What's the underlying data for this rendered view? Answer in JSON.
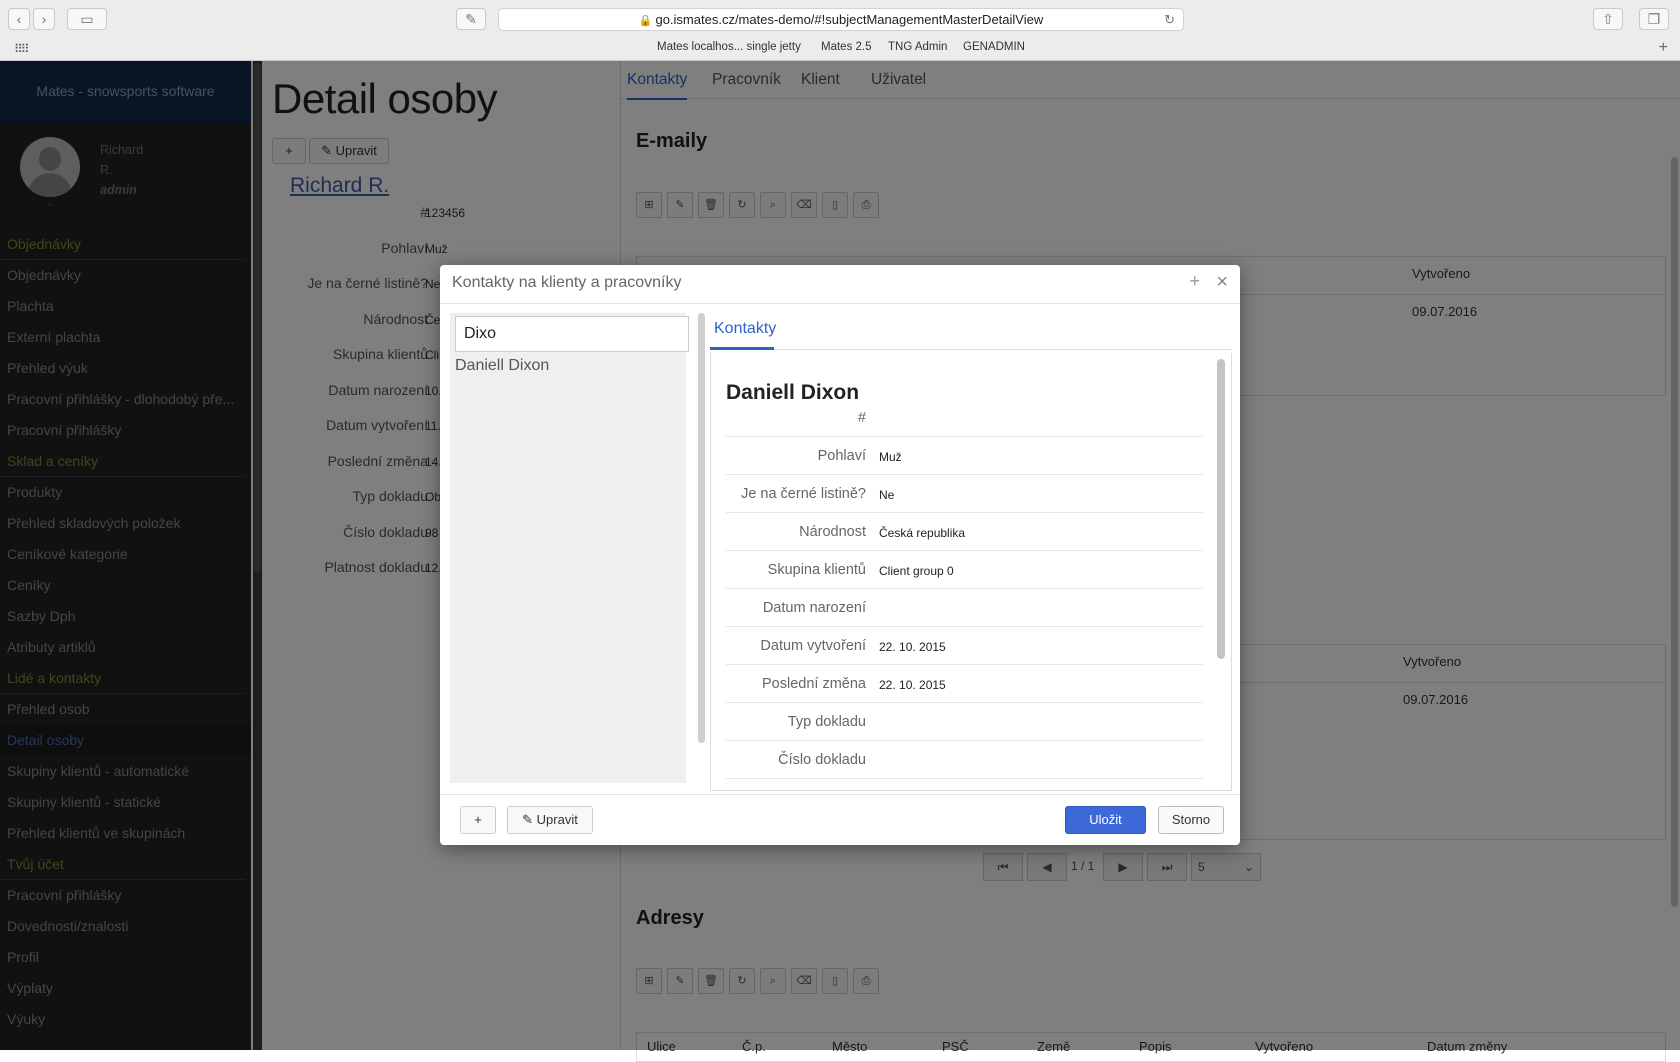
{
  "browser": {
    "url": "go.ismates.cz/mates-demo/#!subjectManagementMasterDetailView",
    "bookmarks": [
      "Mates localhos... single jetty",
      "Mates 2.5",
      "TNG Admin",
      "GENADMIN"
    ]
  },
  "sidebar": {
    "brand": "Mates - snowsports software",
    "user": {
      "first": "Richard",
      "last": "R.",
      "role": "admin"
    },
    "menu": [
      {
        "type": "section",
        "label": "Objednávky"
      },
      {
        "type": "item",
        "label": "Objednávky"
      },
      {
        "type": "item",
        "label": "Plachta"
      },
      {
        "type": "item",
        "label": "Externí plachta"
      },
      {
        "type": "item",
        "label": "Přehled výuk"
      },
      {
        "type": "item",
        "label": "Pracovní přihlášky - dlohodobý pře..."
      },
      {
        "type": "item",
        "label": "Pracovní přihlášky"
      },
      {
        "type": "section",
        "label": "Sklad a ceníky"
      },
      {
        "type": "item",
        "label": "Produkty"
      },
      {
        "type": "item",
        "label": "Přehled skladových položek"
      },
      {
        "type": "item",
        "label": "Ceníkové kategorie"
      },
      {
        "type": "item",
        "label": "Ceníky"
      },
      {
        "type": "item",
        "label": "Sazby Dph"
      },
      {
        "type": "item",
        "label": "Atributy artiklů"
      },
      {
        "type": "section",
        "label": "Lidé a kontakty"
      },
      {
        "type": "item",
        "label": "Přehled osob"
      },
      {
        "type": "item",
        "label": "Detail osoby",
        "active": true
      },
      {
        "type": "item",
        "label": "Skupiny klientů - automatické"
      },
      {
        "type": "item",
        "label": "Skupiny klientů - statické"
      },
      {
        "type": "item",
        "label": "Přehled klientů ve skupinách"
      },
      {
        "type": "section",
        "label": "Tvůj účet"
      },
      {
        "type": "item",
        "label": "Pracovní přihlášky"
      },
      {
        "type": "item",
        "label": "Dovednosti/znalosti"
      },
      {
        "type": "item",
        "label": "Profil"
      },
      {
        "type": "item",
        "label": "Výplaty"
      },
      {
        "type": "item",
        "label": "Výuky"
      }
    ]
  },
  "page": {
    "title": "Detail osoby",
    "add_label": "+",
    "edit_label": "Upravit",
    "person_name": "Richard R.",
    "details": [
      {
        "label": "#",
        "value": "123456"
      },
      {
        "label": "Pohlaví",
        "value": "Muž"
      },
      {
        "label": "Je na černé listině?",
        "value": "Ne"
      },
      {
        "label": "Národnost",
        "value": "Če"
      },
      {
        "label": "Skupina klientů",
        "value": "Cli"
      },
      {
        "label": "Datum narození",
        "value": "10."
      },
      {
        "label": "Datum vytvoření",
        "value": "11."
      },
      {
        "label": "Poslední změna",
        "value": "14."
      },
      {
        "label": "Typ dokladu",
        "value": "Ob"
      },
      {
        "label": "Číslo dokladu",
        "value": "98"
      },
      {
        "label": "Platnost dokladu",
        "value": "12."
      }
    ],
    "tabs": [
      "Kontakty",
      "Pracovník",
      "Klient",
      "Uživatel"
    ],
    "emails_title": "E-maily",
    "col_created": "Vytvořeno",
    "email_created": "09.07.2016",
    "phone_created": "09.07.2016",
    "pager_text": "1 / 1",
    "page_size": "5",
    "addresses_title": "Adresy",
    "address_cols": [
      "Ulice",
      "Č.p.",
      "Město",
      "PSČ",
      "Země",
      "Popis",
      "Vytvořeno",
      "Datum změny"
    ]
  },
  "modal": {
    "title": "Kontakty na klienty a pracovníky",
    "search_value": "Dixo",
    "results": [
      "Daniell Dixon"
    ],
    "tab": "Kontakty",
    "contact_name": "Daniell Dixon",
    "fields": [
      {
        "label": "#",
        "value": ""
      },
      {
        "label": "Pohlaví",
        "value": "Muž"
      },
      {
        "label": "Je na černé listině?",
        "value": "Ne"
      },
      {
        "label": "Národnost",
        "value": "Česká republika"
      },
      {
        "label": "Skupina klientů",
        "value": "Client group 0"
      },
      {
        "label": "Datum narození",
        "value": ""
      },
      {
        "label": "Datum vytvoření",
        "value": "22. 10. 2015"
      },
      {
        "label": "Poslední změna",
        "value": "22. 10. 2015"
      },
      {
        "label": "Typ dokladu",
        "value": ""
      },
      {
        "label": "Číslo dokladu",
        "value": ""
      }
    ],
    "add_label": "+",
    "edit_label": "Upravit",
    "save_label": "Uložit",
    "cancel_label": "Storno"
  },
  "colors": {
    "accent": "#3c68d8",
    "sidebar": "#222222",
    "brand_bar": "#13294e"
  }
}
